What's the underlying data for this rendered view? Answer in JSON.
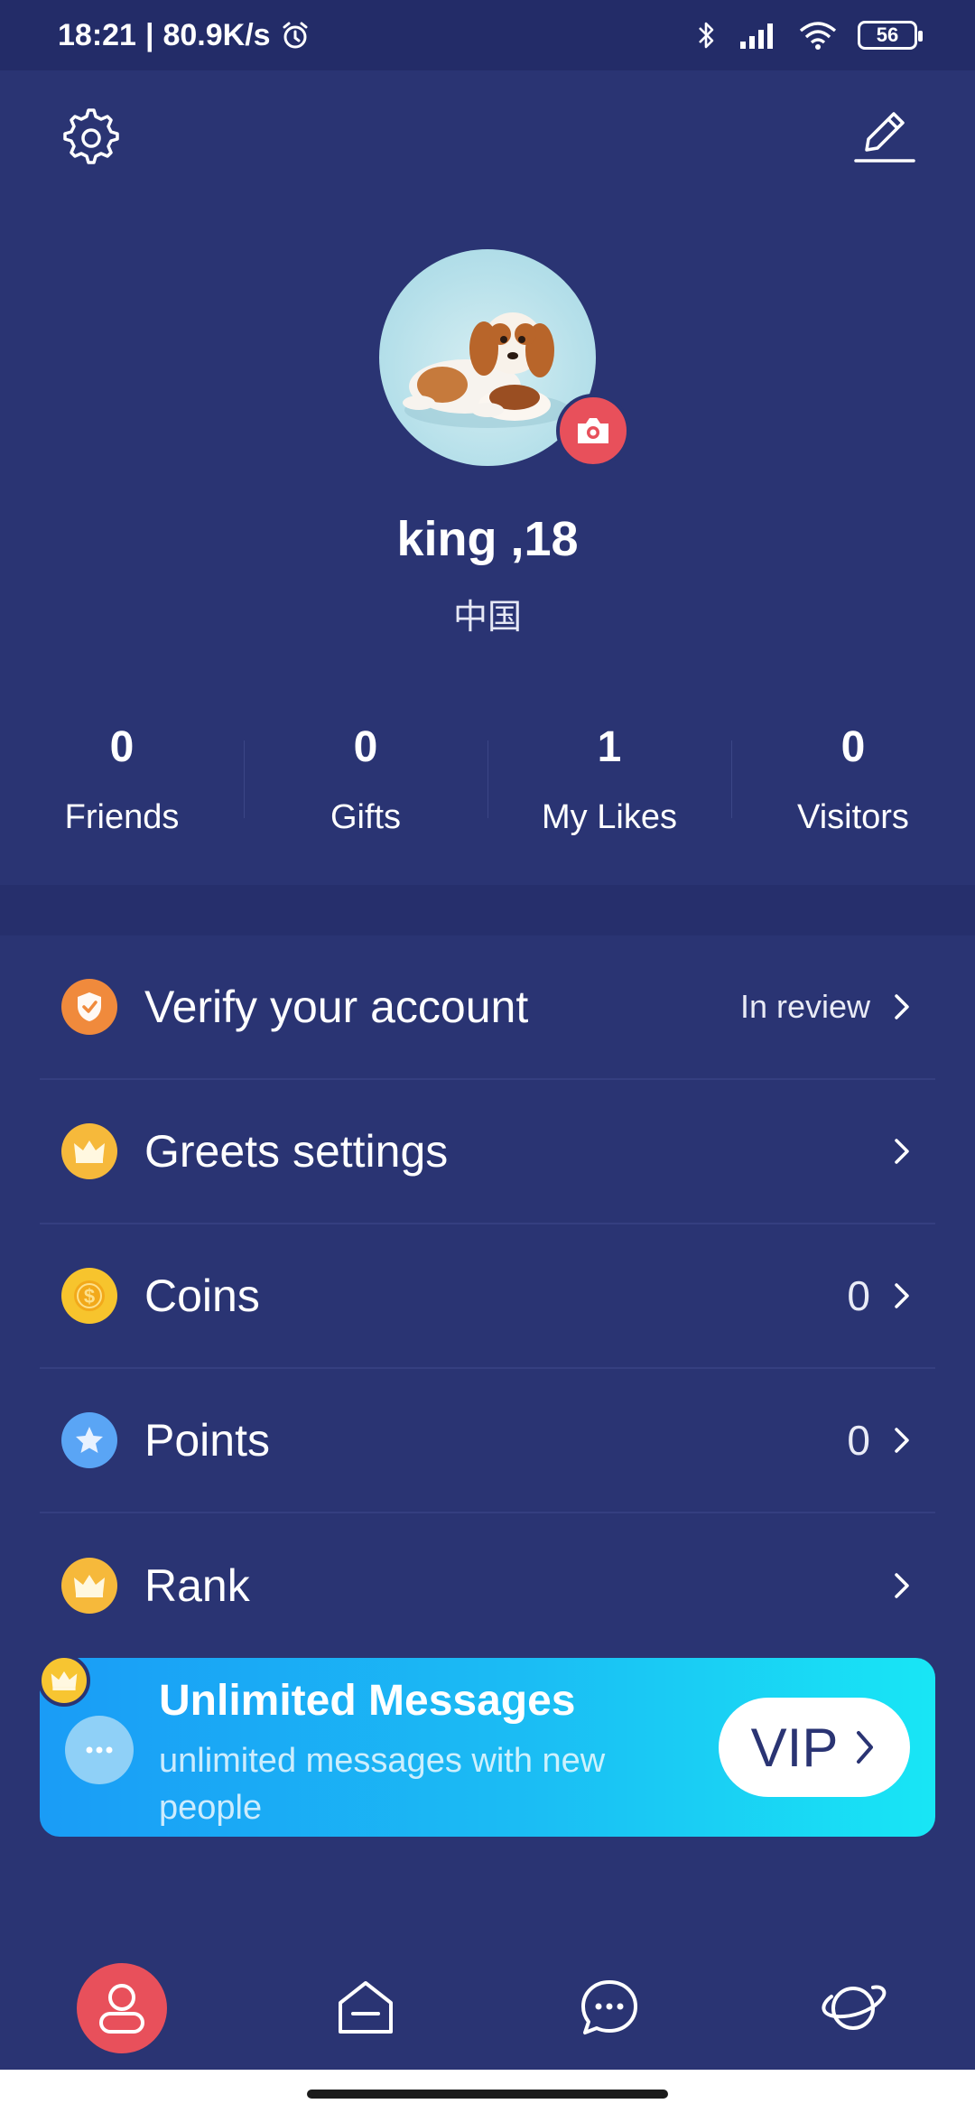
{
  "status_bar": {
    "time": "18:21",
    "speed": "80.9K/s",
    "battery": "56",
    "icons": [
      "alarm-icon",
      "bluetooth-icon",
      "signal-icon",
      "wifi-icon",
      "battery-icon"
    ]
  },
  "header": {
    "left_icon": "gear-icon",
    "right_icon": "edit-icon"
  },
  "profile": {
    "name": "king ,18",
    "country": "中国",
    "avatar_icon": "camera-icon"
  },
  "stats": [
    {
      "value": "0",
      "label": "Friends"
    },
    {
      "value": "0",
      "label": "Gifts"
    },
    {
      "value": "1",
      "label": "My Likes"
    },
    {
      "value": "0",
      "label": "Visitors"
    }
  ],
  "menu": [
    {
      "label": "Verify your account",
      "value": "In review",
      "icon": "shield-icon",
      "color": "#f08a3c"
    },
    {
      "label": "Greets settings",
      "value": "",
      "icon": "crown-icon",
      "color": "#f6b93b"
    },
    {
      "label": "Coins",
      "value": "0",
      "icon": "coin-icon",
      "color": "#f7c42d"
    },
    {
      "label": "Points",
      "value": "0",
      "icon": "star-icon",
      "color": "#5aa5f5"
    },
    {
      "label": "Rank",
      "value": "",
      "icon": "crown-icon",
      "color": "#f6b93b"
    }
  ],
  "vip_banner": {
    "title": "Unlimited Messages",
    "subtitle": "unlimited messages with new people",
    "button_label": "VIP"
  },
  "bottom_nav": [
    {
      "icon": "profile-icon",
      "active": true
    },
    {
      "icon": "home-icon",
      "active": false
    },
    {
      "icon": "chat-icon",
      "active": false
    },
    {
      "icon": "planet-icon",
      "active": false
    }
  ],
  "colors": {
    "background": "#2a3473",
    "accent": "#e8505b",
    "vip_gradient_start": "#1a9cf6",
    "vip_gradient_end": "#18e6f5"
  }
}
